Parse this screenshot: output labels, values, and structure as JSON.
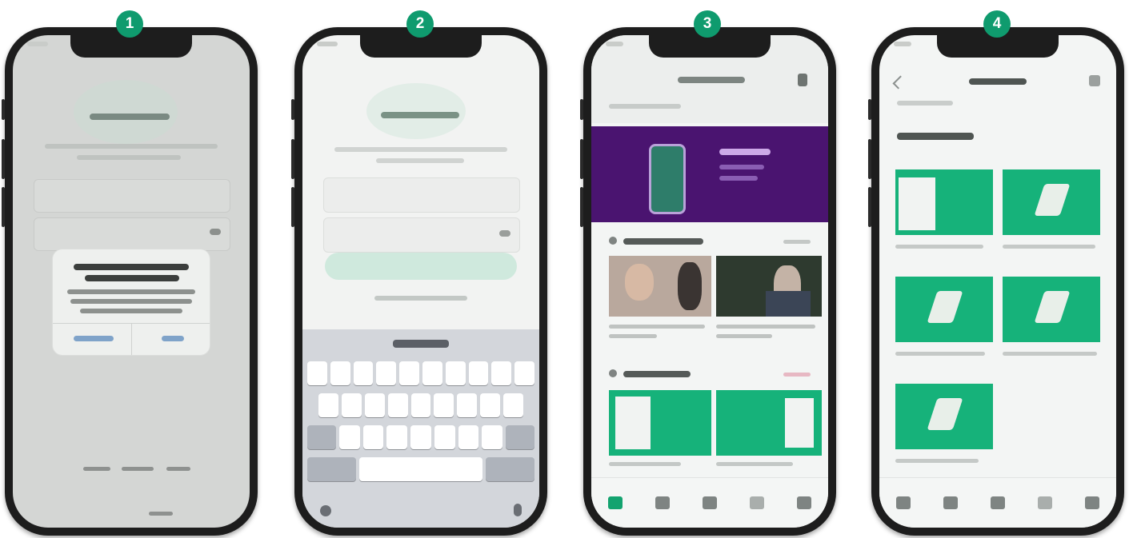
{
  "steps": [
    {
      "number": "1"
    },
    {
      "number": "2"
    },
    {
      "number": "3"
    },
    {
      "number": "4"
    }
  ],
  "colors": {
    "accent": "#0f9b6e",
    "green_tile": "#16b27a",
    "banner_purple": "#4a1470",
    "phone_frame": "#1d1d1d"
  },
  "icons": [
    "phone-frame",
    "keyboard",
    "tab-home-icon",
    "tab-search-icon",
    "tab-library-icon",
    "tab-mic-icon",
    "tab-profile-icon",
    "logo-mark-icon"
  ]
}
